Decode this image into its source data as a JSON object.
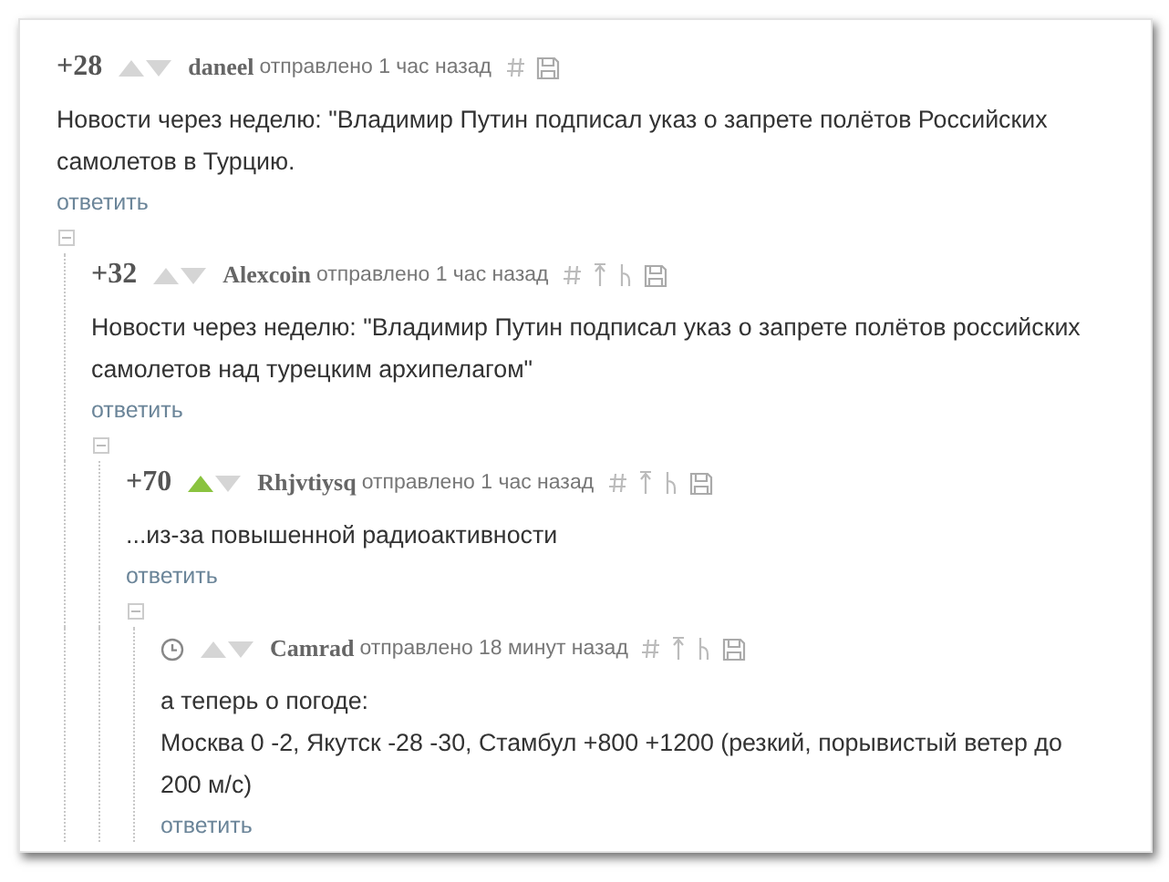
{
  "comments": [
    {
      "kind": "score",
      "score": "+28",
      "upvoted": false,
      "author": "daneel",
      "meta": "отправлено 1 час назад",
      "parent_link": false,
      "text": "Новости через неделю: \"Владимир Путин подписал указ о запрете полётов Российских\nсамолетов в Турцию.",
      "reply": "ответить",
      "children": [
        {
          "kind": "score",
          "score": "+32",
          "upvoted": false,
          "author": "Alexcoin",
          "meta": "отправлено 1 час назад",
          "parent_link": true,
          "text": "Новости через неделю: \"Владимир Путин подписал указ о запрете полётов российских\nсамолетов над турецким архипелагом\"",
          "reply": "ответить",
          "children": [
            {
              "kind": "score",
              "score": "+70",
              "upvoted": true,
              "author": "Rhjvtiysq",
              "meta": "отправлено 1 час назад",
              "parent_link": true,
              "text": "...из-за повышенной радиоактивности",
              "reply": "ответить",
              "children": [
                {
                  "kind": "timer",
                  "upvoted": false,
                  "author": "Camrad",
                  "meta": "отправлено 18 минут назад",
                  "parent_link": true,
                  "text": "а теперь о погоде:\nМосква 0 -2, Якутск -28 -30, Стамбул +800 +1200 (резкий, порывистый ветер до\n200 м/с)",
                  "reply": "ответить"
                }
              ]
            }
          ]
        }
      ]
    }
  ]
}
